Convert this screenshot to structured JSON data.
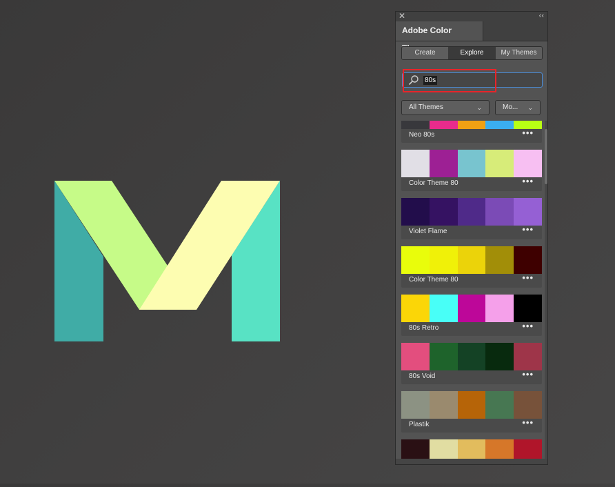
{
  "panel": {
    "title": "Adobe Color Themes",
    "close_glyph": "✕",
    "collapse_glyph": "‹‹",
    "tabs": [
      "Create",
      "Explore",
      "My Themes"
    ],
    "active_tab": "Explore",
    "search": {
      "value": "80s",
      "icon": "search-icon"
    },
    "filters": {
      "themes": "All Themes",
      "sort": "Mo..."
    }
  },
  "themes": [
    {
      "name": "Neo 80s",
      "colors": [
        "#38383c",
        "#e92b8c",
        "#f0a013",
        "#3aaef0",
        "#b8ff14"
      ]
    },
    {
      "name": "Color Theme 80",
      "colors": [
        "#e1dfe6",
        "#9d2094",
        "#78c4cf",
        "#d7ec79",
        "#f7bff2"
      ]
    },
    {
      "name": "Violet Flame",
      "colors": [
        "#220d4b",
        "#351262",
        "#4f2a89",
        "#7b4bb6",
        "#9560d4"
      ]
    },
    {
      "name": "Color Theme 80",
      "colors": [
        "#e9fd0b",
        "#f0f108",
        "#ebd30a",
        "#a28e08",
        "#3e0000"
      ]
    },
    {
      "name": "80s Retro",
      "colors": [
        "#fbd607",
        "#48fff7",
        "#bd0799",
        "#f5a0ea",
        "#000000"
      ]
    },
    {
      "name": "80s Void",
      "colors": [
        "#e34e7e",
        "#1e632b",
        "#144225",
        "#082a0e",
        "#9e3549"
      ]
    },
    {
      "name": "Plastik",
      "colors": [
        "#8c9283",
        "#9a8a6e",
        "#b66408",
        "#477752",
        "#77523a"
      ]
    },
    {
      "name": "",
      "colors": [
        "#2a1014",
        "#e1dda2",
        "#e2bc5d",
        "#d67729",
        "#b0152a"
      ]
    }
  ],
  "artwork": {
    "colors": {
      "left_leg": "#40aca6",
      "right_leg": "#58e2c4",
      "left_diagonal": "#c6fb88",
      "right_diagonal": "#fdfdb1"
    }
  }
}
